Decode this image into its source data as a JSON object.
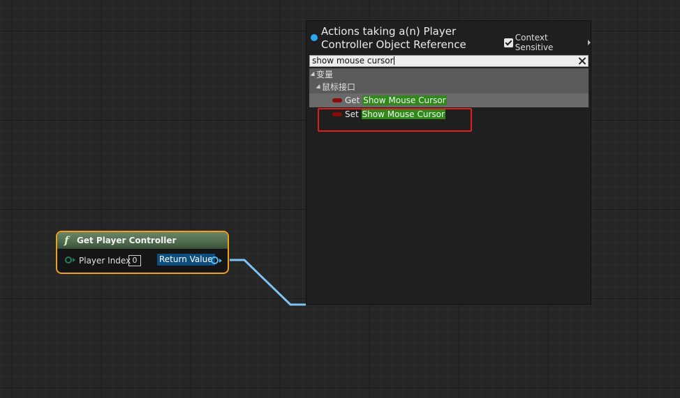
{
  "node": {
    "title": "Get Player Controller",
    "func_icon": "f",
    "input_label": "Player Index",
    "input_value": "0",
    "output_label": "Return Value"
  },
  "menu": {
    "title": "Actions taking a(n) Player Controller Object Reference",
    "context_sensitive_label": "Context Sensitive",
    "context_sensitive_checked": true,
    "search_value": "show mouse cursor",
    "categories": [
      {
        "label": "变量"
      },
      {
        "label": "鼠标接口"
      }
    ],
    "items": [
      {
        "prefix": "Get ",
        "match": "Show Mouse Cursor",
        "selected": true
      },
      {
        "prefix": "Set ",
        "match": "Show Mouse Cursor",
        "selected": false
      }
    ]
  },
  "colors": {
    "node_border": "#f1a01e",
    "wire": "#7ec3f2",
    "highlight": "#2f8a1a",
    "annotation": "#e02020"
  }
}
